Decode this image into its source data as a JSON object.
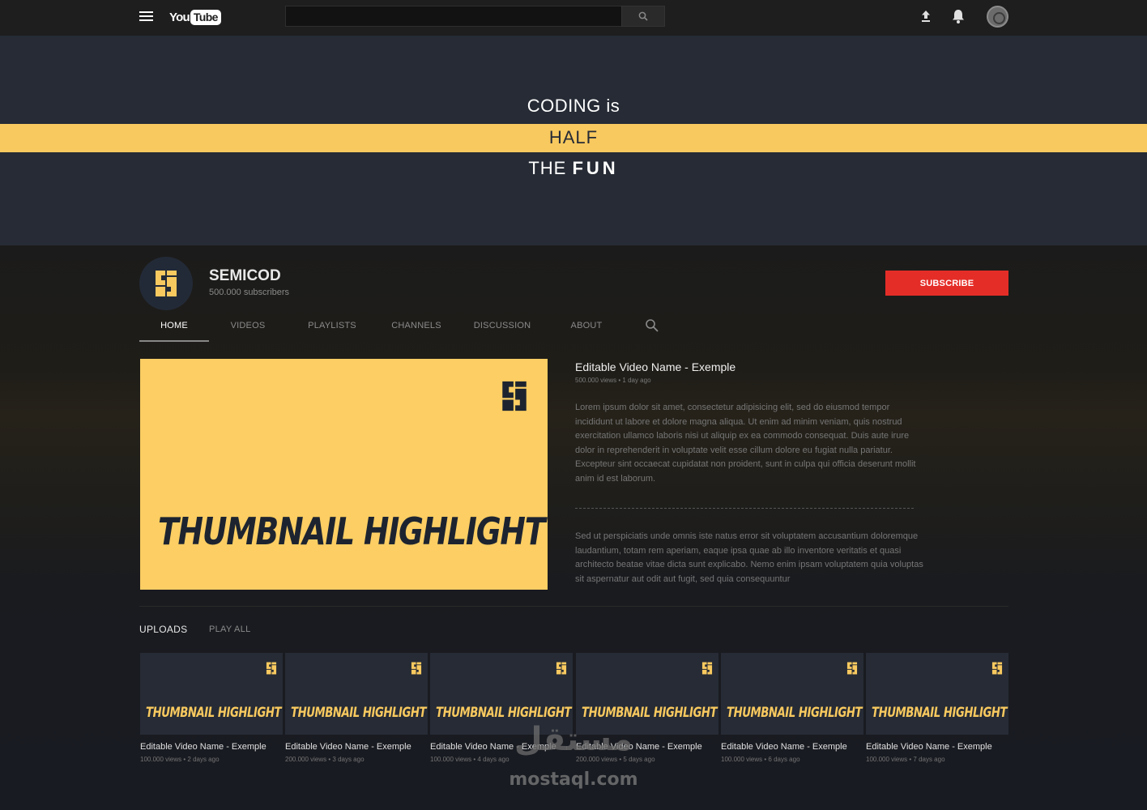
{
  "topbar": {
    "logo_you": "You",
    "logo_tube": "Tube",
    "search_placeholder": ""
  },
  "banner": {
    "line1": "CODING is",
    "line2": "HALF",
    "line3_prefix": "THE ",
    "line3_emph": "FUN"
  },
  "channel": {
    "name": "SEMICOD",
    "subscribers": "500.000 subscribers",
    "subscribe_label": "SUBSCRIBE"
  },
  "tabs": [
    {
      "label": "HOME"
    },
    {
      "label": "VIDEOS"
    },
    {
      "label": "PLAYLISTS"
    },
    {
      "label": "CHANNELS"
    },
    {
      "label": "DISCUSSION"
    },
    {
      "label": "ABOUT"
    }
  ],
  "featured": {
    "thumb_text": "THUMBNAIL HIGHLIGHT",
    "title": "Editable Video Name - Exemple",
    "meta": "500.000 views • 1 day ago",
    "description1": "Lorem ipsum dolor sit amet, consectetur adipisicing elit, sed do eiusmod tempor incididunt ut labore et dolore magna aliqua. Ut enim ad minim veniam, quis nostrud exercitation ullamco laboris nisi ut aliquip ex ea commodo consequat. Duis aute irure dolor in reprehenderit in voluptate velit esse cillum dolore eu fugiat nulla pariatur. Excepteur sint occaecat cupidatat non proident, sunt in culpa qui officia deserunt mollit anim id est laborum.",
    "description2": "Sed ut perspiciatis unde omnis iste natus error sit voluptatem accusantium doloremque laudantium, totam rem aperiam, eaque ipsa quae ab illo inventore veritatis et quasi architecto beatae vitae dicta sunt explicabo. Nemo enim ipsam voluptatem quia voluptas sit aspernatur aut odit aut fugit, sed quia consequuntur"
  },
  "uploads": {
    "label": "UPLOADS",
    "play_all": "PLAY ALL",
    "items": [
      {
        "thumb_text": "THUMBNAIL HIGHLIGHT",
        "title": "Editable Video Name - Exemple",
        "meta": "100.000 views • 2 days ago"
      },
      {
        "thumb_text": "THUMBNAIL HIGHLIGHT",
        "title": "Editable Video Name - Exemple",
        "meta": "200.000 views • 3 days ago"
      },
      {
        "thumb_text": "THUMBNAIL HIGHLIGHT",
        "title": "Editable Video Name - Exemple",
        "meta": "100.000 views • 4 days ago"
      },
      {
        "thumb_text": "THUMBNAIL HIGHLIGHT",
        "title": "Editable Video Name - Exemple",
        "meta": "200.000 views • 5 days ago"
      },
      {
        "thumb_text": "THUMBNAIL HIGHLIGHT",
        "title": "Editable Video Name - Exemple",
        "meta": "100.000 views • 6 days ago"
      },
      {
        "thumb_text": "THUMBNAIL HIGHLIGHT",
        "title": "Editable Video Name - Exemple",
        "meta": "100.000 views • 7 days ago"
      }
    ]
  },
  "watermark": {
    "arabic": "مستقل",
    "latin": "mostaql.com"
  },
  "colors": {
    "accent_yellow": "#f8c95f",
    "banner_bg": "#262b35",
    "subscribe_red": "#e52d27"
  },
  "icons": {
    "menu": "menu-icon",
    "search": "search-icon",
    "upload": "upload-icon",
    "notifications": "bell-icon",
    "account": "avatar",
    "channel_logo": "semicod-logo-icon"
  }
}
